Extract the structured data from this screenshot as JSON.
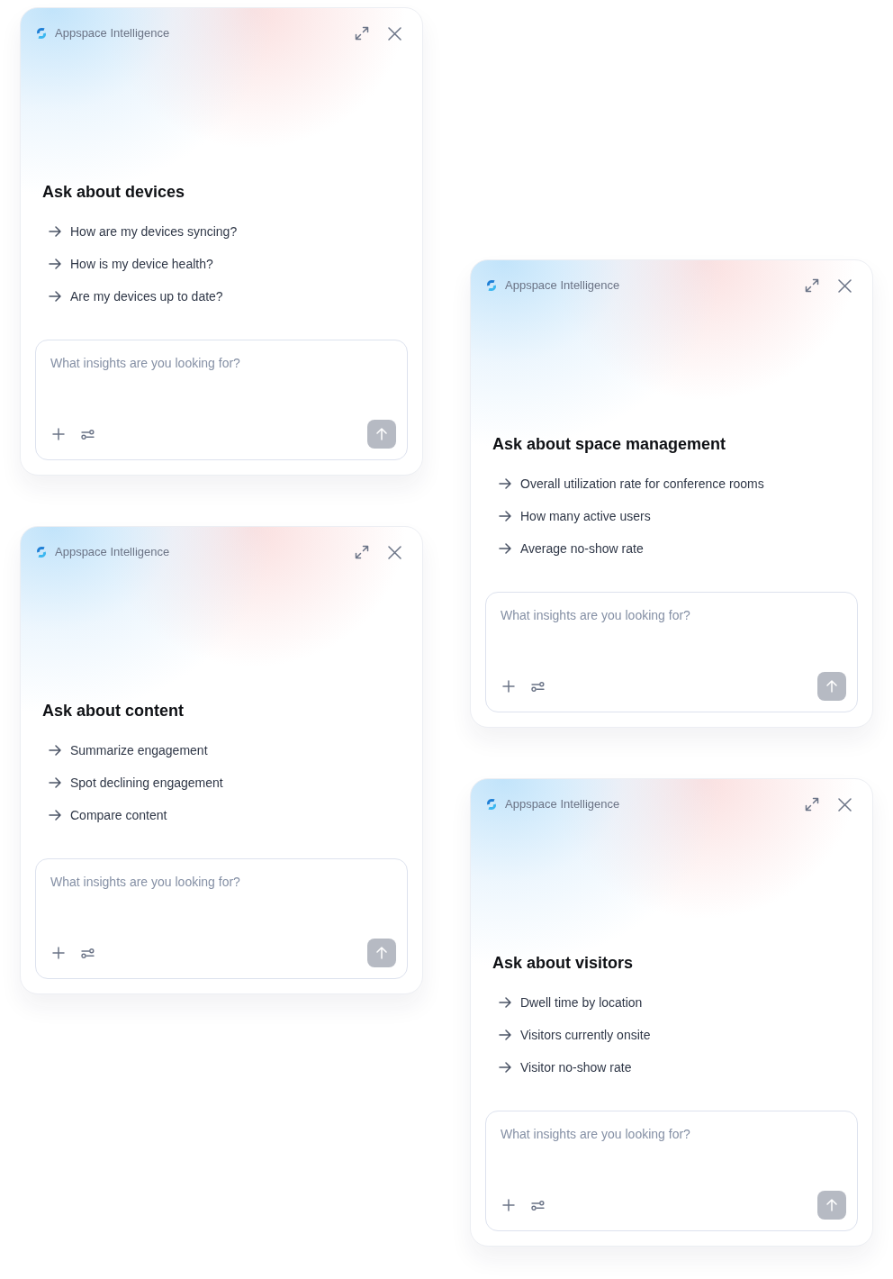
{
  "columns": [
    {
      "cards": [
        {
          "brand": "Appspace Intelligence",
          "title": "Ask about devices",
          "suggestions": [
            "How are my devices syncing?",
            "How is my device health?",
            "Are my devices up to date?"
          ],
          "composer": {
            "placeholder": "What insights are you looking for?",
            "send_disabled": true
          }
        },
        {
          "brand": "Appspace Intelligence",
          "title": "Ask about content",
          "suggestions": [
            "Summarize engagement",
            "Spot declining engagement",
            "Compare content"
          ],
          "composer": {
            "placeholder": "What insights are you looking for?",
            "send_disabled": true
          }
        }
      ]
    },
    {
      "cards": [
        {
          "brand": "Appspace Intelligence",
          "title": "Ask about space management",
          "suggestions": [
            "Overall utilization rate for conference rooms",
            "How many active users",
            "Average no-show rate"
          ],
          "composer": {
            "placeholder": "What insights are you looking for?",
            "send_disabled": true
          }
        },
        {
          "brand": "Appspace Intelligence",
          "title": "Ask about visitors",
          "suggestions": [
            "Dwell time by location",
            "Visitors currently onsite",
            "Visitor no-show rate"
          ],
          "composer": {
            "placeholder": "What insights are you looking for?",
            "send_disabled": true
          }
        }
      ]
    }
  ]
}
